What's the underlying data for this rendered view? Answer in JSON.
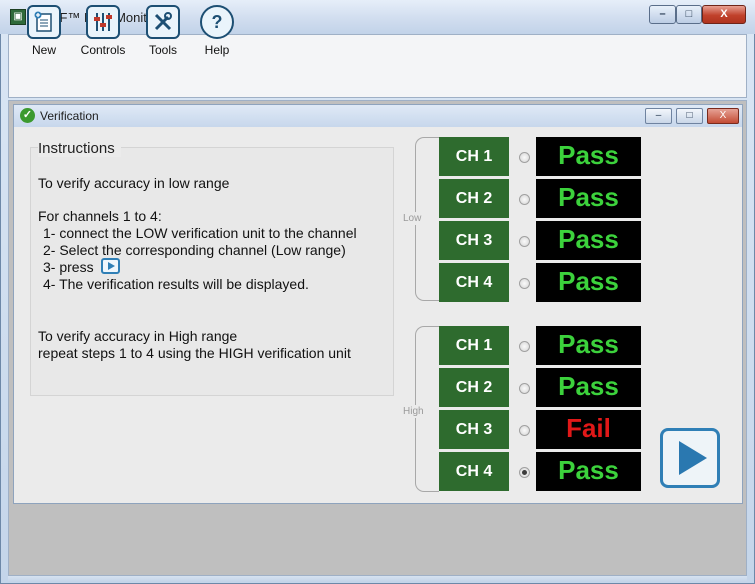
{
  "app": {
    "title": "SURF™ Data Monitor"
  },
  "window_controls": {
    "minimize": "–",
    "maximize": "□",
    "close": "X"
  },
  "toolbar": {
    "items": [
      {
        "label": "New",
        "icon": "new-document-icon"
      },
      {
        "label": "Controls",
        "icon": "sliders-icon"
      },
      {
        "label": "Tools",
        "icon": "tools-icon"
      },
      {
        "label": "Help",
        "icon": "help-icon"
      }
    ]
  },
  "verification": {
    "title": "Verification",
    "controls": {
      "minimize": "–",
      "maximize": "□",
      "close": "X"
    },
    "instructions": {
      "heading": "Instructions",
      "low_intro": "To verify accuracy in low range",
      "channels_intro": "For channels 1 to 4:",
      "step1": "1- connect the LOW verification unit to the channel",
      "step2": "2- Select the corresponding channel (Low range)",
      "step3": "3- press",
      "step4": "4- The verification results will be displayed.",
      "high_intro": "To verify accuracy in High range",
      "high_repeat": "repeat steps 1 to 4 using the HIGH verification unit"
    },
    "groups": [
      {
        "label": "Low",
        "channels": [
          {
            "name": "CH 1",
            "selected": false,
            "result": "Pass"
          },
          {
            "name": "CH 2",
            "selected": false,
            "result": "Pass"
          },
          {
            "name": "CH 3",
            "selected": false,
            "result": "Pass"
          },
          {
            "name": "CH 4",
            "selected": false,
            "result": "Pass"
          }
        ]
      },
      {
        "label": "High",
        "channels": [
          {
            "name": "CH 1",
            "selected": false,
            "result": "Pass"
          },
          {
            "name": "CH 2",
            "selected": false,
            "result": "Pass"
          },
          {
            "name": "CH 3",
            "selected": false,
            "result": "Fail"
          },
          {
            "name": "CH 4",
            "selected": true,
            "result": "Pass"
          }
        ]
      }
    ],
    "colors": {
      "pass": "#3cd23c",
      "fail": "#e01818",
      "channel_button": "#2e6b2e",
      "play_accent": "#2f7fb6"
    }
  }
}
